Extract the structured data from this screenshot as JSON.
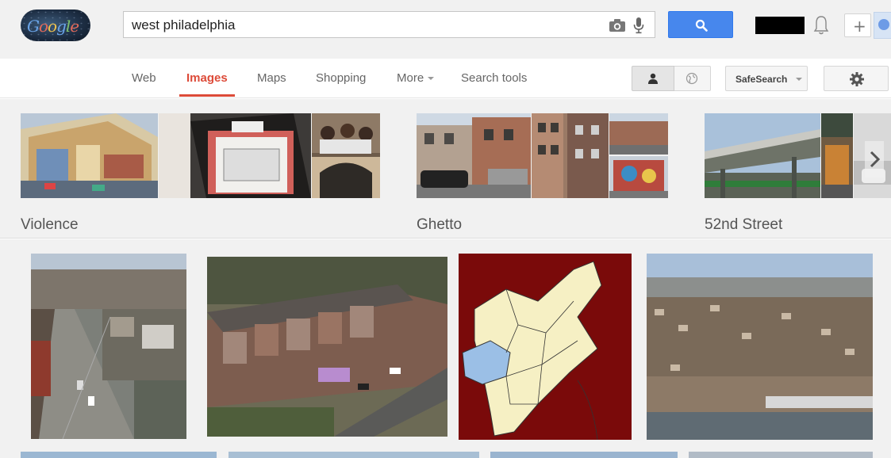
{
  "search": {
    "query": "west philadelphia"
  },
  "icons": {
    "logo": "google-doodle-logo",
    "camera": "camera-icon",
    "mic": "microphone-icon",
    "search": "magnifier-icon",
    "bell": "bell-icon",
    "share": "plus-icon",
    "personal": "person-icon",
    "globe": "globe-icon",
    "settings": "gear-icon",
    "next": "chevron-right-icon"
  },
  "header": {
    "share_label": "+"
  },
  "nav": {
    "tabs": [
      {
        "label": "Web",
        "active": false
      },
      {
        "label": "Images",
        "active": true
      },
      {
        "label": "Maps",
        "active": false
      },
      {
        "label": "Shopping",
        "active": false
      },
      {
        "label": "More",
        "active": false
      },
      {
        "label": "Search tools",
        "active": false
      }
    ],
    "safesearch_label": "SafeSearch"
  },
  "related": [
    {
      "label": "Violence"
    },
    {
      "label": "Ghetto"
    },
    {
      "label": "52nd Street"
    }
  ],
  "colors": {
    "accent": "#dd4b39",
    "search_button": "#4787ed",
    "header_bg": "#f1f1f1",
    "map_bg": "#7a0a0a",
    "map_fill": "#f6f0c4",
    "map_highlight": "#9bbfe6"
  }
}
